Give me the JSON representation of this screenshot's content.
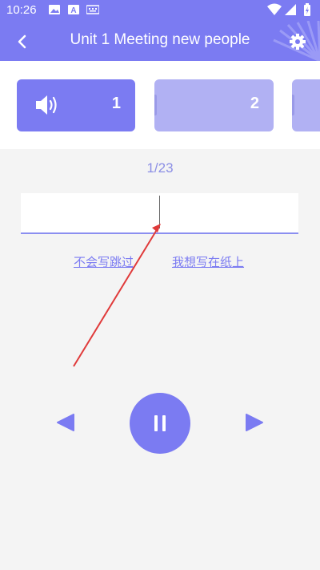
{
  "status_bar": {
    "time": "10:26",
    "icons": [
      "image-icon",
      "font-icon",
      "keyboard-icon",
      "wifi-icon",
      "signal-icon",
      "battery-icon"
    ]
  },
  "header": {
    "title": "Unit 1 Meeting new people",
    "back_icon": "chevron-left-icon",
    "settings_icon": "gear-icon"
  },
  "chunks": [
    {
      "number": "1",
      "state": "active",
      "icon": "speaker-icon"
    },
    {
      "number": "2",
      "state": "inactive"
    },
    {
      "number": "",
      "state": "inactive"
    }
  ],
  "main": {
    "counter": "1/23",
    "answer_value": "",
    "skip_link": "不会写跳过",
    "paper_link": "我想写在纸上"
  },
  "controls": {
    "prev_icon": "triangle-left-icon",
    "pause_icon": "pause-icon",
    "next_icon": "triangle-right-icon"
  },
  "colors": {
    "primary": "#7b7bf2",
    "primary_light": "#b1b1f3",
    "background": "#f4f4f4",
    "annotation_arrow": "#e03a3a"
  }
}
